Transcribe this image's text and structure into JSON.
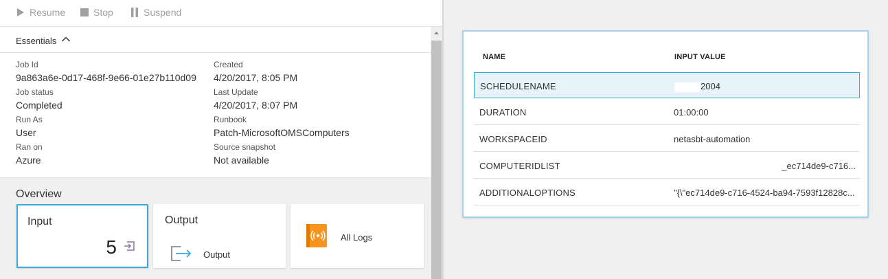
{
  "toolbar": {
    "resume_label": "Resume",
    "stop_label": "Stop",
    "suspend_label": "Suspend"
  },
  "essentials": {
    "title": "Essentials",
    "left_fields": [
      {
        "label": "Job Id",
        "value": "9a863a6e-0d17-468f-9e66-01e27b110d09"
      },
      {
        "label": "Job status",
        "value": "Completed"
      },
      {
        "label": "Run As",
        "value": "User"
      },
      {
        "label": "Ran on",
        "value": "Azure"
      }
    ],
    "right_fields": [
      {
        "label": "Created",
        "value": "4/20/2017, 8:05 PM"
      },
      {
        "label": "Last Update",
        "value": "4/20/2017, 8:07 PM"
      },
      {
        "label": "Runbook",
        "value": "Patch-MicrosoftOMSComputers"
      },
      {
        "label": "Source snapshot",
        "value": "Not available"
      }
    ]
  },
  "overview": {
    "title": "Overview",
    "input": {
      "title": "Input",
      "count": "5"
    },
    "output": {
      "title": "Output",
      "link_label": "Output"
    },
    "logs": {
      "label": "All Logs"
    }
  },
  "input_table": {
    "col_name": "NAME",
    "col_value": "INPUT VALUE",
    "rows": [
      {
        "name": "SCHEDULENAME",
        "value": "2004",
        "redacted_prefix": true
      },
      {
        "name": "DURATION",
        "value": "01:00:00"
      },
      {
        "name": "WORKSPACEID",
        "value": "netasbt-automation"
      },
      {
        "name": "COMPUTERIDLIST",
        "value": "_ec714de9-c716..."
      },
      {
        "name": "ADDITIONALOPTIONS",
        "value": "\"{\\\"ec714de9-c716-4524-ba94-7593f12828c..."
      }
    ]
  },
  "colors": {
    "accent": "#3aa9d4",
    "panel_border": "#a7d3ea",
    "selected_row_bg": "#e6f4f9",
    "logs_icon": "#f7941d"
  }
}
